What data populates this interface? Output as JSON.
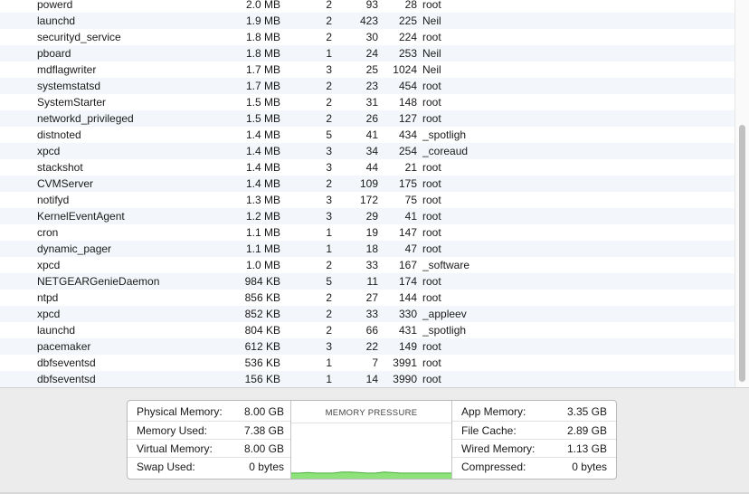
{
  "processes": [
    {
      "name": "powerd",
      "memory": "2.0 MB",
      "threads": "2",
      "ports": "93",
      "pid": "28",
      "user": "root"
    },
    {
      "name": "launchd",
      "memory": "1.9 MB",
      "threads": "2",
      "ports": "423",
      "pid": "225",
      "user": "Neil"
    },
    {
      "name": "securityd_service",
      "memory": "1.8 MB",
      "threads": "2",
      "ports": "30",
      "pid": "224",
      "user": "root"
    },
    {
      "name": "pboard",
      "memory": "1.8 MB",
      "threads": "1",
      "ports": "24",
      "pid": "253",
      "user": "Neil"
    },
    {
      "name": "mdflagwriter",
      "memory": "1.7 MB",
      "threads": "3",
      "ports": "25",
      "pid": "1024",
      "user": "Neil"
    },
    {
      "name": "systemstatsd",
      "memory": "1.7 MB",
      "threads": "2",
      "ports": "23",
      "pid": "454",
      "user": "root"
    },
    {
      "name": "SystemStarter",
      "memory": "1.5 MB",
      "threads": "2",
      "ports": "31",
      "pid": "148",
      "user": "root"
    },
    {
      "name": "networkd_privileged",
      "memory": "1.5 MB",
      "threads": "2",
      "ports": "26",
      "pid": "127",
      "user": "root"
    },
    {
      "name": "distnoted",
      "memory": "1.4 MB",
      "threads": "5",
      "ports": "41",
      "pid": "434",
      "user": "_spotligh"
    },
    {
      "name": "xpcd",
      "memory": "1.4 MB",
      "threads": "3",
      "ports": "34",
      "pid": "254",
      "user": "_coreaud"
    },
    {
      "name": "stackshot",
      "memory": "1.4 MB",
      "threads": "3",
      "ports": "44",
      "pid": "21",
      "user": "root"
    },
    {
      "name": "CVMServer",
      "memory": "1.4 MB",
      "threads": "2",
      "ports": "109",
      "pid": "175",
      "user": "root"
    },
    {
      "name": "notifyd",
      "memory": "1.3 MB",
      "threads": "3",
      "ports": "172",
      "pid": "75",
      "user": "root"
    },
    {
      "name": "KernelEventAgent",
      "memory": "1.2 MB",
      "threads": "3",
      "ports": "29",
      "pid": "41",
      "user": "root"
    },
    {
      "name": "cron",
      "memory": "1.1 MB",
      "threads": "1",
      "ports": "19",
      "pid": "147",
      "user": "root"
    },
    {
      "name": "dynamic_pager",
      "memory": "1.1 MB",
      "threads": "1",
      "ports": "18",
      "pid": "47",
      "user": "root"
    },
    {
      "name": "xpcd",
      "memory": "1.0 MB",
      "threads": "2",
      "ports": "33",
      "pid": "167",
      "user": "_software"
    },
    {
      "name": "NETGEARGenieDaemon",
      "memory": "984 KB",
      "threads": "5",
      "ports": "11",
      "pid": "174",
      "user": "root"
    },
    {
      "name": "ntpd",
      "memory": "856 KB",
      "threads": "2",
      "ports": "27",
      "pid": "144",
      "user": "root"
    },
    {
      "name": "xpcd",
      "memory": "852 KB",
      "threads": "2",
      "ports": "33",
      "pid": "330",
      "user": "_appleev"
    },
    {
      "name": "launchd",
      "memory": "804 KB",
      "threads": "2",
      "ports": "66",
      "pid": "431",
      "user": "_spotligh"
    },
    {
      "name": "pacemaker",
      "memory": "612 KB",
      "threads": "3",
      "ports": "22",
      "pid": "149",
      "user": "root"
    },
    {
      "name": "dbfseventsd",
      "memory": "536 KB",
      "threads": "1",
      "ports": "7",
      "pid": "3991",
      "user": "root"
    },
    {
      "name": "dbfseventsd",
      "memory": "156 KB",
      "threads": "1",
      "ports": "14",
      "pid": "3990",
      "user": "root"
    }
  ],
  "memory_stats": {
    "left": [
      {
        "label": "Physical Memory:",
        "value": "8.00 GB"
      },
      {
        "label": "Memory Used:",
        "value": "7.38 GB"
      },
      {
        "label": "Virtual Memory:",
        "value": "8.00 GB"
      },
      {
        "label": "Swap Used:",
        "value": "0 bytes"
      }
    ],
    "right": [
      {
        "label": "App Memory:",
        "value": "3.35 GB"
      },
      {
        "label": "File Cache:",
        "value": "2.89 GB"
      },
      {
        "label": "Wired Memory:",
        "value": "1.13 GB"
      },
      {
        "label": "Compressed:",
        "value": "0 bytes"
      }
    ]
  },
  "memory_pressure": {
    "title": "MEMORY PRESSURE",
    "color": "#8ee27a",
    "line_color": "#4cae3c",
    "levels": [
      0.1,
      0.1,
      0.11,
      0.1,
      0.1,
      0.1,
      0.12,
      0.12,
      0.11,
      0.1,
      0.1,
      0.12,
      0.11,
      0.1,
      0.1,
      0.1,
      0.1,
      0.1,
      0.1,
      0.1
    ]
  }
}
